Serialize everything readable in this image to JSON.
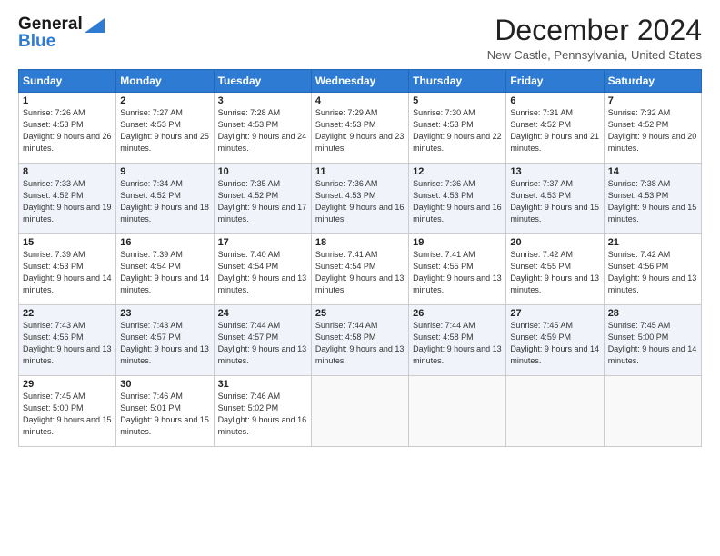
{
  "logo": {
    "line1": "General",
    "line2": "Blue",
    "triangle_color": "#2e7bd4"
  },
  "title": "December 2024",
  "location": "New Castle, Pennsylvania, United States",
  "header_days": [
    "Sunday",
    "Monday",
    "Tuesday",
    "Wednesday",
    "Thursday",
    "Friday",
    "Saturday"
  ],
  "weeks": [
    [
      {
        "day": "1",
        "sunrise": "Sunrise: 7:26 AM",
        "sunset": "Sunset: 4:53 PM",
        "daylight": "Daylight: 9 hours and 26 minutes."
      },
      {
        "day": "2",
        "sunrise": "Sunrise: 7:27 AM",
        "sunset": "Sunset: 4:53 PM",
        "daylight": "Daylight: 9 hours and 25 minutes."
      },
      {
        "day": "3",
        "sunrise": "Sunrise: 7:28 AM",
        "sunset": "Sunset: 4:53 PM",
        "daylight": "Daylight: 9 hours and 24 minutes."
      },
      {
        "day": "4",
        "sunrise": "Sunrise: 7:29 AM",
        "sunset": "Sunset: 4:53 PM",
        "daylight": "Daylight: 9 hours and 23 minutes."
      },
      {
        "day": "5",
        "sunrise": "Sunrise: 7:30 AM",
        "sunset": "Sunset: 4:53 PM",
        "daylight": "Daylight: 9 hours and 22 minutes."
      },
      {
        "day": "6",
        "sunrise": "Sunrise: 7:31 AM",
        "sunset": "Sunset: 4:52 PM",
        "daylight": "Daylight: 9 hours and 21 minutes."
      },
      {
        "day": "7",
        "sunrise": "Sunrise: 7:32 AM",
        "sunset": "Sunset: 4:52 PM",
        "daylight": "Daylight: 9 hours and 20 minutes."
      }
    ],
    [
      {
        "day": "8",
        "sunrise": "Sunrise: 7:33 AM",
        "sunset": "Sunset: 4:52 PM",
        "daylight": "Daylight: 9 hours and 19 minutes."
      },
      {
        "day": "9",
        "sunrise": "Sunrise: 7:34 AM",
        "sunset": "Sunset: 4:52 PM",
        "daylight": "Daylight: 9 hours and 18 minutes."
      },
      {
        "day": "10",
        "sunrise": "Sunrise: 7:35 AM",
        "sunset": "Sunset: 4:52 PM",
        "daylight": "Daylight: 9 hours and 17 minutes."
      },
      {
        "day": "11",
        "sunrise": "Sunrise: 7:36 AM",
        "sunset": "Sunset: 4:53 PM",
        "daylight": "Daylight: 9 hours and 16 minutes."
      },
      {
        "day": "12",
        "sunrise": "Sunrise: 7:36 AM",
        "sunset": "Sunset: 4:53 PM",
        "daylight": "Daylight: 9 hours and 16 minutes."
      },
      {
        "day": "13",
        "sunrise": "Sunrise: 7:37 AM",
        "sunset": "Sunset: 4:53 PM",
        "daylight": "Daylight: 9 hours and 15 minutes."
      },
      {
        "day": "14",
        "sunrise": "Sunrise: 7:38 AM",
        "sunset": "Sunset: 4:53 PM",
        "daylight": "Daylight: 9 hours and 15 minutes."
      }
    ],
    [
      {
        "day": "15",
        "sunrise": "Sunrise: 7:39 AM",
        "sunset": "Sunset: 4:53 PM",
        "daylight": "Daylight: 9 hours and 14 minutes."
      },
      {
        "day": "16",
        "sunrise": "Sunrise: 7:39 AM",
        "sunset": "Sunset: 4:54 PM",
        "daylight": "Daylight: 9 hours and 14 minutes."
      },
      {
        "day": "17",
        "sunrise": "Sunrise: 7:40 AM",
        "sunset": "Sunset: 4:54 PM",
        "daylight": "Daylight: 9 hours and 13 minutes."
      },
      {
        "day": "18",
        "sunrise": "Sunrise: 7:41 AM",
        "sunset": "Sunset: 4:54 PM",
        "daylight": "Daylight: 9 hours and 13 minutes."
      },
      {
        "day": "19",
        "sunrise": "Sunrise: 7:41 AM",
        "sunset": "Sunset: 4:55 PM",
        "daylight": "Daylight: 9 hours and 13 minutes."
      },
      {
        "day": "20",
        "sunrise": "Sunrise: 7:42 AM",
        "sunset": "Sunset: 4:55 PM",
        "daylight": "Daylight: 9 hours and 13 minutes."
      },
      {
        "day": "21",
        "sunrise": "Sunrise: 7:42 AM",
        "sunset": "Sunset: 4:56 PM",
        "daylight": "Daylight: 9 hours and 13 minutes."
      }
    ],
    [
      {
        "day": "22",
        "sunrise": "Sunrise: 7:43 AM",
        "sunset": "Sunset: 4:56 PM",
        "daylight": "Daylight: 9 hours and 13 minutes."
      },
      {
        "day": "23",
        "sunrise": "Sunrise: 7:43 AM",
        "sunset": "Sunset: 4:57 PM",
        "daylight": "Daylight: 9 hours and 13 minutes."
      },
      {
        "day": "24",
        "sunrise": "Sunrise: 7:44 AM",
        "sunset": "Sunset: 4:57 PM",
        "daylight": "Daylight: 9 hours and 13 minutes."
      },
      {
        "day": "25",
        "sunrise": "Sunrise: 7:44 AM",
        "sunset": "Sunset: 4:58 PM",
        "daylight": "Daylight: 9 hours and 13 minutes."
      },
      {
        "day": "26",
        "sunrise": "Sunrise: 7:44 AM",
        "sunset": "Sunset: 4:58 PM",
        "daylight": "Daylight: 9 hours and 13 minutes."
      },
      {
        "day": "27",
        "sunrise": "Sunrise: 7:45 AM",
        "sunset": "Sunset: 4:59 PM",
        "daylight": "Daylight: 9 hours and 14 minutes."
      },
      {
        "day": "28",
        "sunrise": "Sunrise: 7:45 AM",
        "sunset": "Sunset: 5:00 PM",
        "daylight": "Daylight: 9 hours and 14 minutes."
      }
    ],
    [
      {
        "day": "29",
        "sunrise": "Sunrise: 7:45 AM",
        "sunset": "Sunset: 5:00 PM",
        "daylight": "Daylight: 9 hours and 15 minutes."
      },
      {
        "day": "30",
        "sunrise": "Sunrise: 7:46 AM",
        "sunset": "Sunset: 5:01 PM",
        "daylight": "Daylight: 9 hours and 15 minutes."
      },
      {
        "day": "31",
        "sunrise": "Sunrise: 7:46 AM",
        "sunset": "Sunset: 5:02 PM",
        "daylight": "Daylight: 9 hours and 16 minutes."
      },
      null,
      null,
      null,
      null
    ]
  ],
  "accent_color": "#2e7bd4"
}
